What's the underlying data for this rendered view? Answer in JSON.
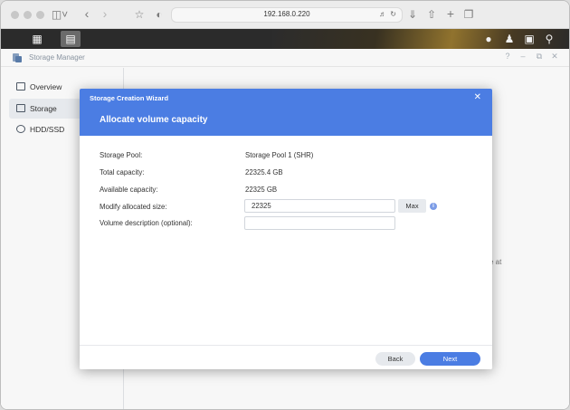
{
  "browser": {
    "url": "192.168.0.220"
  },
  "app": {
    "title": "Storage Manager"
  },
  "sidebar": {
    "items": [
      {
        "label": "Overview"
      },
      {
        "label": "Storage"
      },
      {
        "label": "HDD/SSD"
      }
    ]
  },
  "background": {
    "fragment": "e at"
  },
  "dialog": {
    "wizard_title": "Storage Creation Wizard",
    "heading": "Allocate volume capacity",
    "rows": [
      {
        "label": "Storage Pool:",
        "value": "Storage Pool 1 (SHR)"
      },
      {
        "label": "Total capacity:",
        "value": "22325.4 GB"
      },
      {
        "label": "Available capacity:",
        "value": "22325 GB"
      },
      {
        "label": "Modify allocated size:",
        "value": "22325"
      },
      {
        "label": "Volume description (optional):",
        "value": ""
      }
    ],
    "max_label": "Max",
    "back_label": "Back",
    "next_label": "Next"
  },
  "colors": {
    "accent": "#4b7de3",
    "taskbar": "#2b2b2b"
  }
}
